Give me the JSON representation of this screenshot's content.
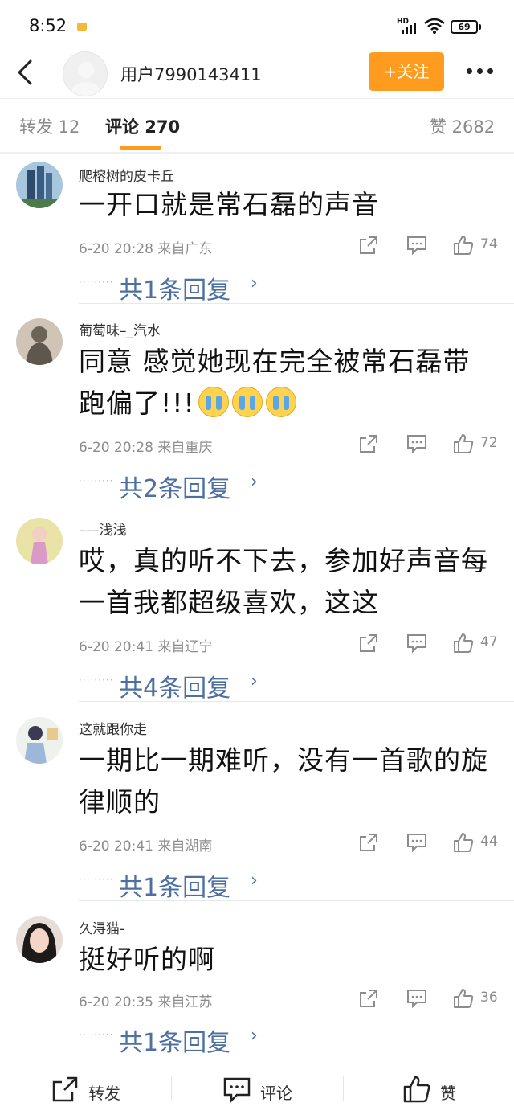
{
  "status_bar": {
    "time": "8:52",
    "network_label": "HD",
    "battery": "69"
  },
  "header": {
    "username": "用户7990143411",
    "follow_label": "+关注"
  },
  "tabs": {
    "repost": "转发 12",
    "comments": "评论 270",
    "likes": "赞 2682"
  },
  "comments": [
    {
      "name": "爬榕树的皮卡丘",
      "text": "一开口就是常石磊的声音",
      "emoji_count": 0,
      "meta": "6-20 20:28  来自广东",
      "likes": "74",
      "replies": "共1条回复"
    },
    {
      "name": "葡萄味–_汽水",
      "text": "同意 感觉她现在完全被常石磊带跑偏了!!!",
      "emoji_count": 3,
      "meta": "6-20 20:28  来自重庆",
      "likes": "72",
      "replies": "共2条回复"
    },
    {
      "name": "–––浅浅",
      "text": "哎，真的听不下去，参加好声音每一首我都超级喜欢，这这",
      "emoji_count": 0,
      "meta": "6-20 20:41  来自辽宁",
      "likes": "47",
      "replies": "共4条回复"
    },
    {
      "name": "这就跟你走",
      "text": "一期比一期难听，没有一首歌的旋律顺的",
      "emoji_count": 0,
      "meta": "6-20 20:41  来自湖南",
      "likes": "44",
      "replies": "共1条回复"
    },
    {
      "name": "久浔猫-",
      "text": "挺好听的啊",
      "emoji_count": 0,
      "meta": "6-20 20:35  来自江苏",
      "likes": "36",
      "replies": "共1条回复"
    }
  ],
  "bottom_bar": {
    "repost": "转发",
    "comment": "评论",
    "like": "赞"
  },
  "colors": {
    "accent": "#ff9c1f",
    "link": "#4d6fa2",
    "muted": "#8c8c8c"
  }
}
